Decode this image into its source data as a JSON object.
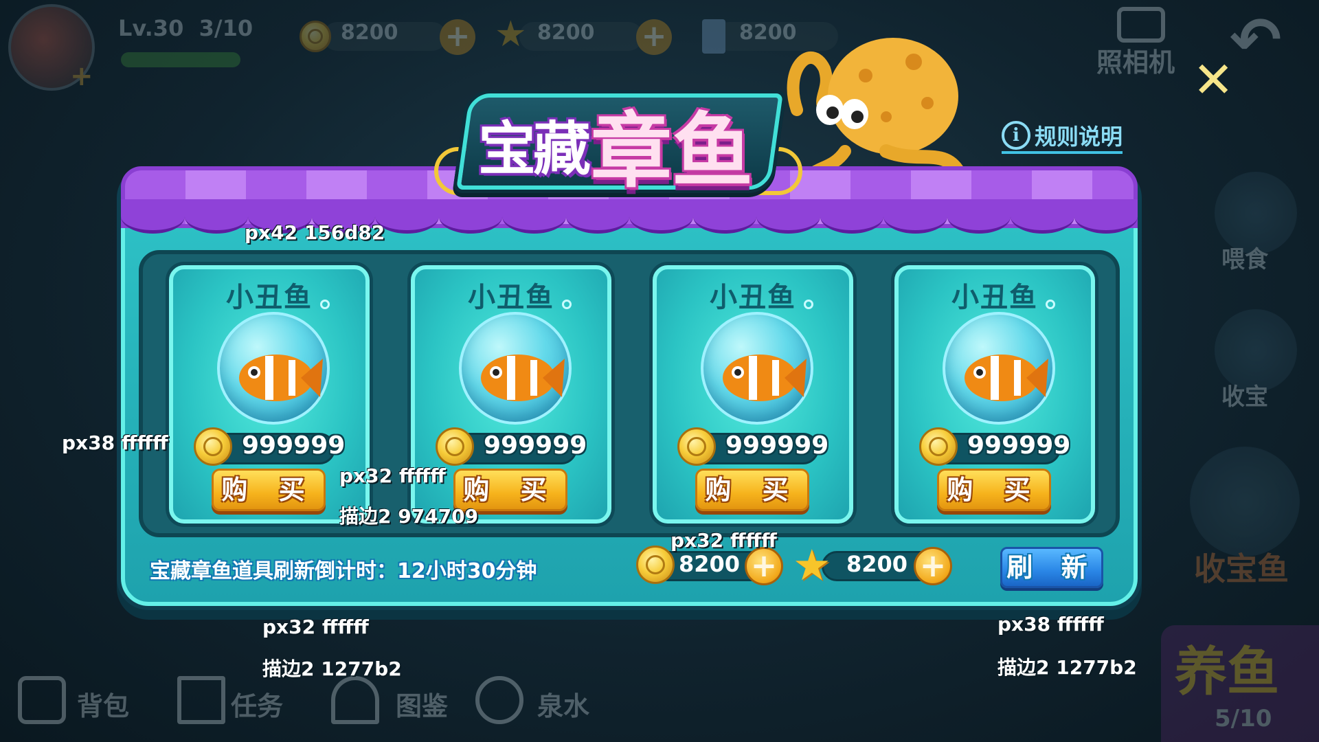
{
  "hud": {
    "level": "Lv.30",
    "level_progress": "3/10",
    "level_fill": 0.95,
    "resources": [
      {
        "icon": "coin-icon",
        "value": "8200"
      },
      {
        "icon": "star-icon",
        "value": "8200"
      },
      {
        "icon": "milk-carton-icon",
        "value": "8200"
      }
    ],
    "camera_label": "照相机"
  },
  "side_menu": {
    "feed_label": "喂食",
    "collect_label": "收宝",
    "collect_fish_label": "收宝鱼",
    "raise_fish_label": "养鱼",
    "raise_fish_count": "5/10"
  },
  "bottom_menu": {
    "bag_label": "背包",
    "task_label": "任务",
    "atlas_label": "图鉴",
    "spring_label": "泉水"
  },
  "popup": {
    "title_part1": "宝藏",
    "title_part2": "章鱼",
    "rules_label": "规则说明",
    "items": [
      {
        "name": "小丑鱼",
        "price": "999999",
        "buy_label": "购 买"
      },
      {
        "name": "小丑鱼",
        "price": "999999",
        "buy_label": "购 买"
      },
      {
        "name": "小丑鱼",
        "price": "999999",
        "buy_label": "购 买"
      },
      {
        "name": "小丑鱼",
        "price": "999999",
        "buy_label": "购 买"
      }
    ],
    "countdown_text": "宝藏章鱼道具刷新倒计时：12小时30分钟",
    "coin_balance": "8200",
    "star_balance": "8200",
    "refresh_label": "刷 新"
  },
  "design_notes": {
    "n1": "px42 156d82",
    "n2": "px38 ffffff",
    "n3": "px32 ffffff",
    "n4": "描边2 974709",
    "n5": "px32 ffffff",
    "n6": "px32 ffffff",
    "n7": "描边2 1277b2",
    "n8": "px38 ffffff",
    "n9": "描边2 1277b2"
  },
  "colors": {
    "panel": "#2fc4c8",
    "awning": "#a75ce8",
    "buy_button": "#f6b31c",
    "buy_stroke": "#974709",
    "refresh_button": "#2a86e6",
    "text_stroke": "#1277b2"
  }
}
